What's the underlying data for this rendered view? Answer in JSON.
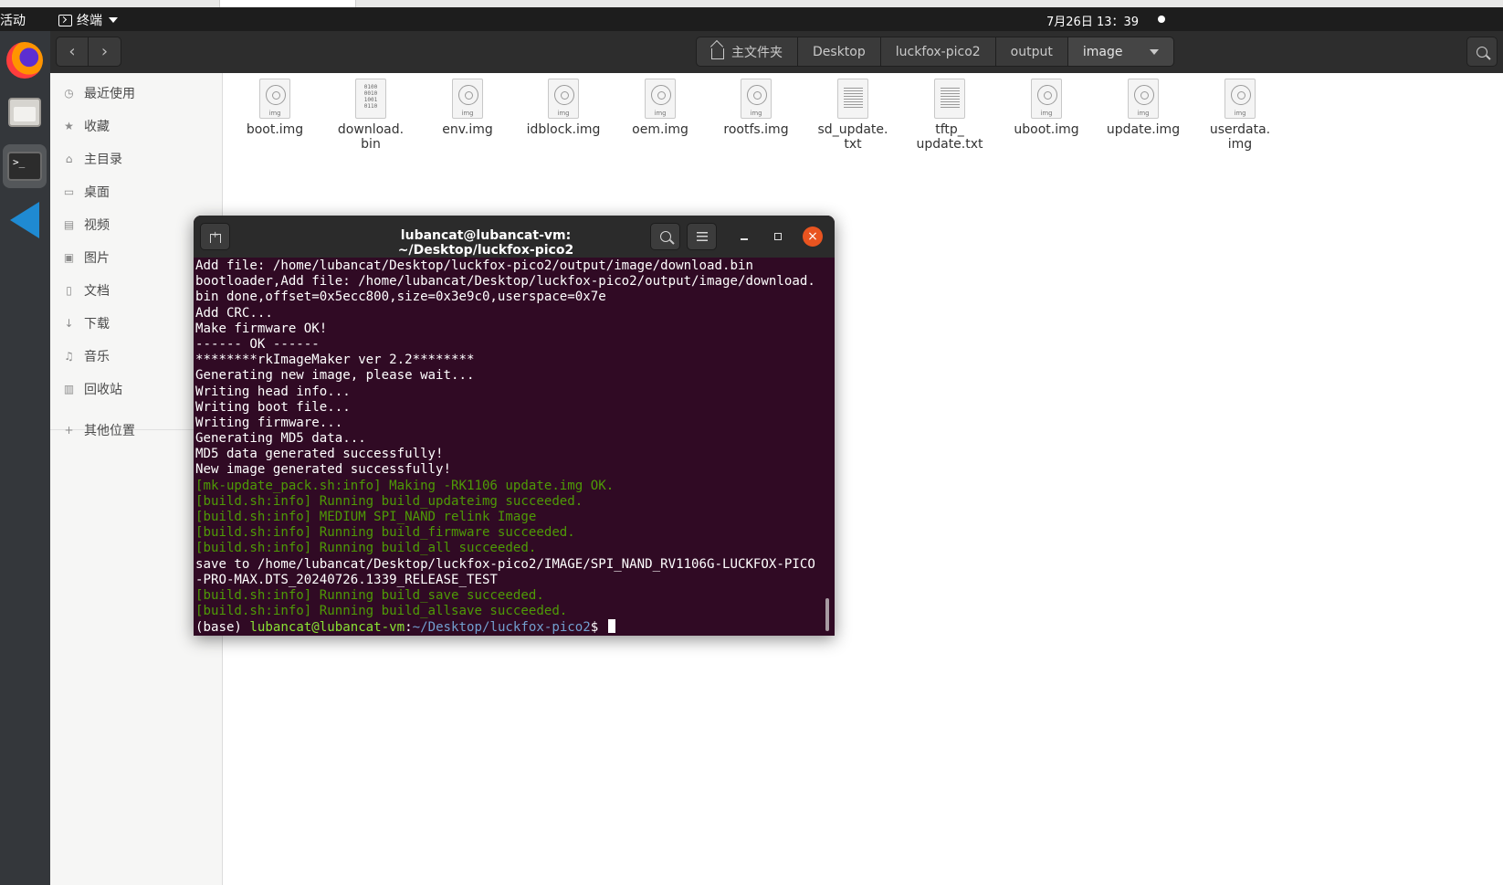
{
  "topbar": {
    "activities": "活动",
    "app_name": "终端",
    "clock": "7月26日 13：39"
  },
  "dock": {
    "items": [
      {
        "name": "Firefox",
        "icon": "firefox-icon"
      },
      {
        "name": "Files",
        "icon": "files-icon"
      },
      {
        "name": "Terminal",
        "icon": "terminal-icon"
      },
      {
        "name": "Visual Studio Code",
        "icon": "vscode-icon"
      }
    ],
    "terminal_glyph": ">_"
  },
  "filemanager": {
    "breadcrumbs": [
      "主文件夹",
      "Desktop",
      "luckfox-pico2",
      "output",
      "image"
    ],
    "sidebar": [
      {
        "label": "最近使用",
        "icon": "clock-icon"
      },
      {
        "label": "收藏",
        "icon": "star-icon"
      },
      {
        "label": "主目录",
        "icon": "home-icon"
      },
      {
        "label": "桌面",
        "icon": "desktop-icon"
      },
      {
        "label": "视频",
        "icon": "video-icon"
      },
      {
        "label": "图片",
        "icon": "image-icon"
      },
      {
        "label": "文档",
        "icon": "document-icon"
      },
      {
        "label": "下载",
        "icon": "download-icon"
      },
      {
        "label": "音乐",
        "icon": "music-icon"
      },
      {
        "label": "回收站",
        "icon": "trash-icon"
      },
      {
        "label": "其他位置",
        "icon": "plus-icon"
      }
    ],
    "files": [
      {
        "line1": "boot.img",
        "line2": "",
        "kind": "img"
      },
      {
        "line1": "download.",
        "line2": "bin",
        "kind": "bin"
      },
      {
        "line1": "env.img",
        "line2": "",
        "kind": "img"
      },
      {
        "line1": "idblock.img",
        "line2": "",
        "kind": "img"
      },
      {
        "line1": "oem.img",
        "line2": "",
        "kind": "img"
      },
      {
        "line1": "rootfs.img",
        "line2": "",
        "kind": "img"
      },
      {
        "line1": "sd_update.",
        "line2": "txt",
        "kind": "txt"
      },
      {
        "line1": "tftp_",
        "line2": "update.txt",
        "kind": "txt"
      },
      {
        "line1": "uboot.img",
        "line2": "",
        "kind": "img"
      },
      {
        "line1": "update.img",
        "line2": "",
        "kind": "img"
      },
      {
        "line1": "userdata.",
        "line2": "img",
        "kind": "img"
      }
    ],
    "img_badge": "img",
    "bin_glyph": "0100\n0010\n1001\n0110"
  },
  "terminal": {
    "title": "lubancat@lubancat-vm: ~/Desktop/luckfox-pico2",
    "lines": [
      {
        "text": "Add file: /home/lubancat/Desktop/luckfox-pico2/output/image/download.bin",
        "color": "white"
      },
      {
        "text": "bootloader,Add file: /home/lubancat/Desktop/luckfox-pico2/output/image/download.",
        "color": "white"
      },
      {
        "text": "bin done,offset=0x5ecc800,size=0x3e9c0,userspace=0x7e",
        "color": "white"
      },
      {
        "text": "Add CRC...",
        "color": "white"
      },
      {
        "text": "Make firmware OK!",
        "color": "white"
      },
      {
        "text": "------ OK ------",
        "color": "white"
      },
      {
        "text": "********rkImageMaker ver 2.2********",
        "color": "white"
      },
      {
        "text": "Generating new image, please wait...",
        "color": "white"
      },
      {
        "text": "Writing head info...",
        "color": "white"
      },
      {
        "text": "Writing boot file...",
        "color": "white"
      },
      {
        "text": "Writing firmware...",
        "color": "white"
      },
      {
        "text": "Generating MD5 data...",
        "color": "white"
      },
      {
        "text": "MD5 data generated successfully!",
        "color": "white"
      },
      {
        "text": "New image generated successfully!",
        "color": "white"
      },
      {
        "text": "[mk-update_pack.sh:info] Making -RK1106 update.img OK.",
        "color": "green"
      },
      {
        "text": "[build.sh:info] Running build_updateimg succeeded.",
        "color": "green"
      },
      {
        "text": "[build.sh:info] MEDIUM SPI_NAND relink Image",
        "color": "green"
      },
      {
        "text": "[build.sh:info] Running build_firmware succeeded.",
        "color": "green"
      },
      {
        "text": "[build.sh:info] Running build_all succeeded.",
        "color": "green"
      },
      {
        "text": "save to /home/lubancat/Desktop/luckfox-pico2/IMAGE/SPI_NAND_RV1106G-LUCKFOX-PICO",
        "color": "white"
      },
      {
        "text": "-PRO-MAX.DTS_20240726.1339_RELEASE_TEST",
        "color": "white"
      },
      {
        "text": "[build.sh:info] Running build_save succeeded.",
        "color": "green"
      },
      {
        "text": "[build.sh:info] Running build_allsave succeeded.",
        "color": "green"
      }
    ],
    "prompt": {
      "env": "(base) ",
      "user_host": "lubancat@lubancat-vm",
      "sep": ":",
      "path": "~/Desktop/luckfox-pico2",
      "symbol": "$ "
    }
  },
  "colors": {
    "terminal_bg": "#300a24",
    "green": "#4e9a06",
    "prompt_green": "#8ae234",
    "prompt_blue": "#729fcf",
    "close_orange": "#e95420"
  }
}
